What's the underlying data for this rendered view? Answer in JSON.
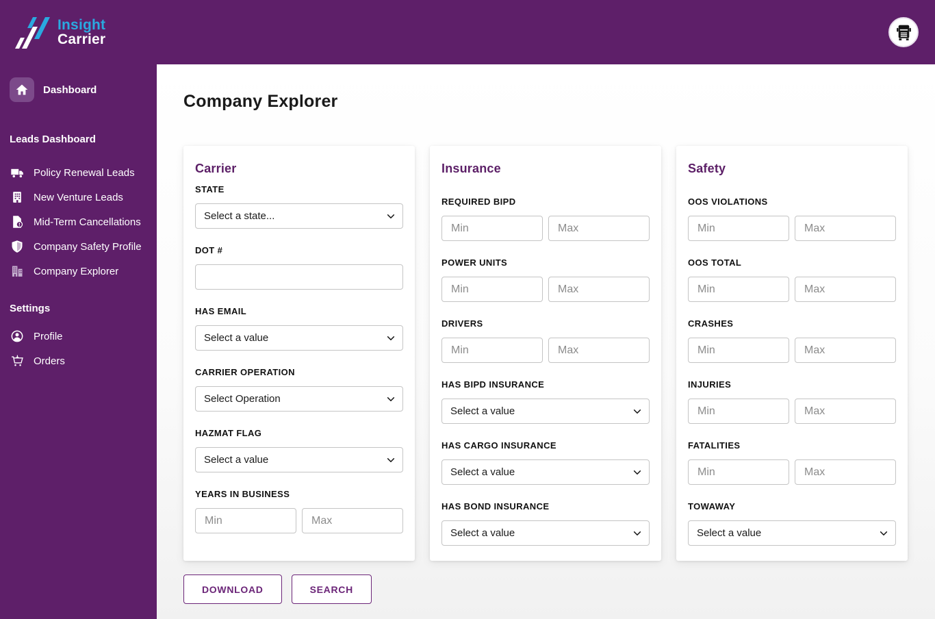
{
  "brand": {
    "line1": "Insight",
    "line2": "Carrier",
    "logo_icon": "double-slash-logo-icon"
  },
  "header": {
    "avatar_icon": "truck-avatar-icon"
  },
  "sidebar": {
    "dashboard": {
      "label": "Dashboard",
      "icon": "home-icon"
    },
    "sections": [
      {
        "title": "Leads Dashboard",
        "items": [
          {
            "label": "Policy Renewal Leads",
            "icon": "truck-icon"
          },
          {
            "label": "New Venture Leads",
            "icon": "building-icon"
          },
          {
            "label": "Mid-Term Cancellations",
            "icon": "file-alert-icon"
          },
          {
            "label": "Company Safety Profile",
            "icon": "shield-icon"
          },
          {
            "label": "Company Explorer",
            "icon": "buildings-icon"
          }
        ]
      },
      {
        "title": "Settings",
        "items": [
          {
            "label": "Profile",
            "icon": "user-icon"
          },
          {
            "label": "Orders",
            "icon": "cart-icon"
          }
        ]
      }
    ]
  },
  "main": {
    "title": "Company Explorer",
    "cards": [
      {
        "title": "Carrier",
        "fields": [
          {
            "label": "STATE",
            "type": "select",
            "value": "Select a state..."
          },
          {
            "label": "DOT #",
            "type": "text",
            "value": ""
          },
          {
            "label": "HAS EMAIL",
            "type": "select",
            "value": "Select a value"
          },
          {
            "label": "CARRIER OPERATION",
            "type": "select",
            "value": "Select Operation"
          },
          {
            "label": "HAZMAT FLAG",
            "type": "select",
            "value": "Select a value"
          },
          {
            "label": "YEARS IN BUSINESS",
            "type": "range",
            "min_placeholder": "Min",
            "max_placeholder": "Max"
          }
        ]
      },
      {
        "title": "Insurance",
        "fields": [
          {
            "label": "REQUIRED BIPD",
            "type": "range",
            "min_placeholder": "Min",
            "max_placeholder": "Max"
          },
          {
            "label": "POWER UNITS",
            "type": "range",
            "min_placeholder": "Min",
            "max_placeholder": "Max"
          },
          {
            "label": "DRIVERS",
            "type": "range",
            "min_placeholder": "Min",
            "max_placeholder": "Max"
          },
          {
            "label": "HAS BIPD INSURANCE",
            "type": "select",
            "value": "Select a value"
          },
          {
            "label": "HAS CARGO INSURANCE",
            "type": "select",
            "value": "Select a value"
          },
          {
            "label": "HAS BOND INSURANCE",
            "type": "select",
            "value": "Select a value"
          }
        ]
      },
      {
        "title": "Safety",
        "fields": [
          {
            "label": "OOS VIOLATIONS",
            "type": "range",
            "min_placeholder": "Min",
            "max_placeholder": "Max"
          },
          {
            "label": "OOS TOTAL",
            "type": "range",
            "min_placeholder": "Min",
            "max_placeholder": "Max"
          },
          {
            "label": "CRASHES",
            "type": "range",
            "min_placeholder": "Min",
            "max_placeholder": "Max"
          },
          {
            "label": "INJURIES",
            "type": "range",
            "min_placeholder": "Min",
            "max_placeholder": "Max"
          },
          {
            "label": "FATALITIES",
            "type": "range",
            "min_placeholder": "Min",
            "max_placeholder": "Max"
          },
          {
            "label": "TOWAWAY",
            "type": "select",
            "value": "Select a value"
          }
        ]
      }
    ],
    "actions": {
      "download": "DOWNLOAD",
      "search": "SEARCH"
    }
  },
  "colors": {
    "purple_bg": "#5E1F69",
    "accent_purple": "#6B2578",
    "card_title_purple": "#5C1F67",
    "logo_blue": "#2AA9E0",
    "dashboard_tile": "#7C4A8A",
    "muted_icon": "#C4AECE"
  }
}
